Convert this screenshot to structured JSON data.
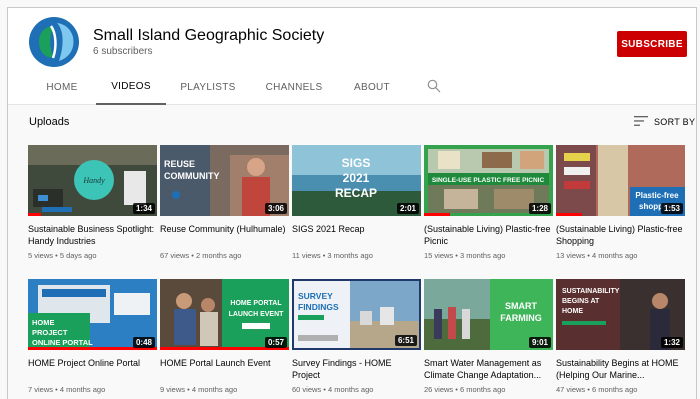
{
  "channel": {
    "name": "Small Island Geographic Society",
    "subscribers": "6 subscribers",
    "subscribe_label": "SUBSCRIBE"
  },
  "tabs": [
    "HOME",
    "VIDEOS",
    "PLAYLISTS",
    "CHANNELS",
    "ABOUT"
  ],
  "active_tab": "VIDEOS",
  "section_title": "Uploads",
  "sort_label": "SORT BY",
  "colors": {
    "subscribe": "#cc0000",
    "progress": "#ff0000",
    "avatar_blue": "#1e6fb5",
    "avatar_green": "#1aa05a"
  },
  "videos": [
    {
      "title": "Sustainable Business Spotlight: Handy Industries",
      "views": "5 views",
      "age": "5 days ago",
      "duration": "1:34",
      "thumb_text": "",
      "watched": 0.1
    },
    {
      "title": "Reuse Community (Hulhumale)",
      "views": "67 views",
      "age": "2 months ago",
      "duration": "3:06",
      "thumb_text": "REUSE COMMUNITY",
      "watched": 0
    },
    {
      "title": "SIGS 2021 Recap",
      "views": "11 views",
      "age": "3 months ago",
      "duration": "2:01",
      "thumb_text": "SIGS 2021 RECAP",
      "watched": 0
    },
    {
      "title": "(Sustainable Living) Plastic-free Picnic",
      "views": "15 views",
      "age": "3 months ago",
      "duration": "1:28",
      "thumb_text": "SINGLE-USE PLASTIC FREE PICNIC",
      "watched": 0.2
    },
    {
      "title": "(Sustainable Living) Plastic-free Shopping",
      "views": "13 views",
      "age": "4 months ago",
      "duration": "1:53",
      "thumb_text": "Plastic-free shopping",
      "watched": 0.2
    },
    {
      "title": "HOME Project Online Portal",
      "views": "7 views",
      "age": "4 months ago",
      "duration": "0:48",
      "thumb_text": "HOME PROJECT ONLINE PORTAL",
      "watched": 1.0
    },
    {
      "title": "HOME Portal Launch Event",
      "views": "9 views",
      "age": "4 months ago",
      "duration": "0:57",
      "thumb_text": "HOME PORTAL LAUNCH EVENT",
      "watched": 1.0
    },
    {
      "title": "Survey Findings - HOME Project",
      "views": "60 views",
      "age": "4 months ago",
      "duration": "6:51",
      "thumb_text": "SURVEY FINDINGS",
      "watched": 0
    },
    {
      "title": "Smart Water Management as Climate Change Adaptation...",
      "views": "26 views",
      "age": "6 months ago",
      "duration": "9:01",
      "thumb_text": "SMART FARMING",
      "watched": 0
    },
    {
      "title": "Sustainability Begins at HOME (Helping Our Marine...",
      "views": "47 views",
      "age": "6 months ago",
      "duration": "1:32",
      "thumb_text": "SUSTAINABILITY BEGINS AT HOME",
      "watched": 0
    }
  ]
}
